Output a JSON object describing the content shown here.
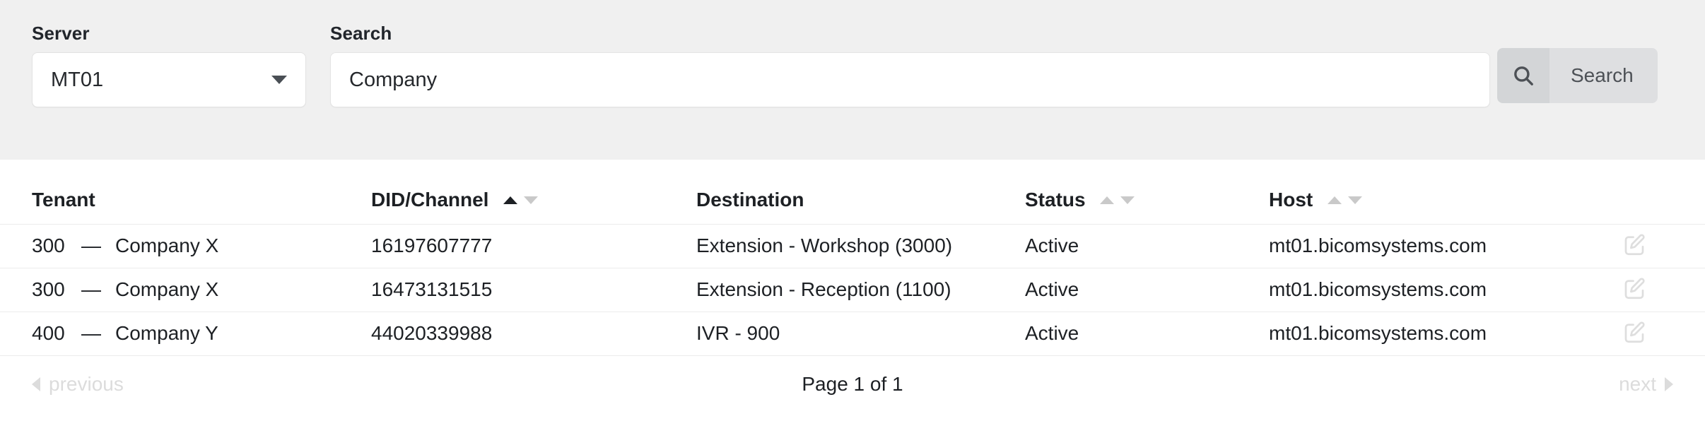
{
  "toolbar": {
    "server": {
      "label": "Server",
      "selected": "MT01",
      "caret_icon": "chevron-down-icon"
    },
    "search": {
      "label": "Search",
      "value": "Company",
      "placeholder": "Search",
      "button_label": "Search",
      "button_icon": "search-icon"
    }
  },
  "table": {
    "columns": [
      {
        "key": "tenant",
        "label": "Tenant",
        "sortable": false,
        "sort": "none"
      },
      {
        "key": "did",
        "label": "DID/Channel",
        "sortable": true,
        "sort": "asc"
      },
      {
        "key": "dest",
        "label": "Destination",
        "sortable": false,
        "sort": "none"
      },
      {
        "key": "status",
        "label": "Status",
        "sortable": true,
        "sort": "none"
      },
      {
        "key": "host",
        "label": "Host",
        "sortable": true,
        "sort": "none"
      },
      {
        "key": "actions",
        "label": "",
        "sortable": false,
        "sort": "none"
      }
    ],
    "rows": [
      {
        "tenant_id": "300",
        "tenant_dash": "—",
        "tenant_name": "Company X",
        "did": "16197607777",
        "destination": "Extension - Workshop (3000)",
        "status": "Active",
        "host": "mt01.bicomsystems.com",
        "action_icon": "edit-icon"
      },
      {
        "tenant_id": "300",
        "tenant_dash": "—",
        "tenant_name": "Company X",
        "did": "16473131515",
        "destination": "Extension - Reception (1100)",
        "status": "Active",
        "host": "mt01.bicomsystems.com",
        "action_icon": "edit-icon"
      },
      {
        "tenant_id": "400",
        "tenant_dash": "—",
        "tenant_name": "Company Y",
        "did": "44020339988",
        "destination": "IVR - 900",
        "status": "Active",
        "host": "mt01.bicomsystems.com",
        "action_icon": "edit-icon"
      }
    ]
  },
  "pagination": {
    "previous_label": "previous",
    "next_label": "next",
    "page_info": "Page 1 of 1",
    "previous_icon": "triangle-left-icon",
    "next_icon": "triangle-right-icon",
    "previous_enabled": false,
    "next_enabled": false
  },
  "colors": {
    "toolbar_bg": "#f0f0f0",
    "content_bg": "#ffffff",
    "status_active": "#2d7a2d",
    "text_primary": "#1d2024",
    "muted": "#dcdcdc",
    "button_icon_bg": "#d3d5d7",
    "button_label_bg": "#dedfe1",
    "row_border": "#ececec"
  }
}
